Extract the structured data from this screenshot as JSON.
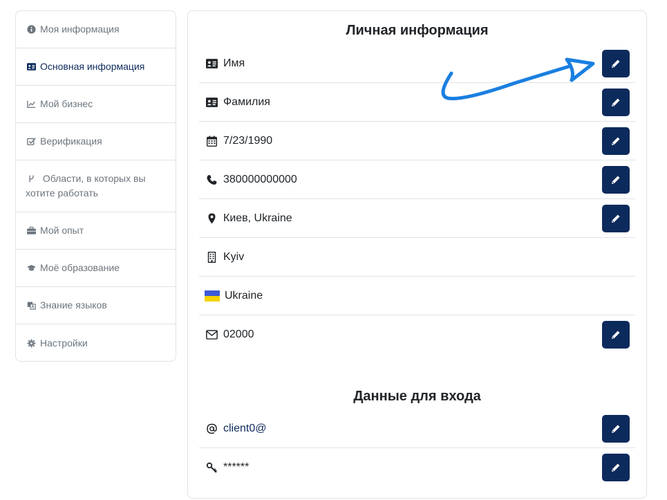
{
  "sidebar": {
    "items": [
      {
        "label": "Моя информация",
        "icon": "info-icon"
      },
      {
        "label": "Основная информация",
        "icon": "id-card-icon",
        "active": true
      },
      {
        "label": "Мой бизнес",
        "icon": "line-chart-icon"
      },
      {
        "label": "Верификация",
        "icon": "checkbox-icon"
      },
      {
        "label": "Области, в которых вы хотите работать",
        "icon": "branch-icon"
      },
      {
        "label": "Мой опыт",
        "icon": "briefcase-icon"
      },
      {
        "label": "Моё образование",
        "icon": "graduation-cap-icon"
      },
      {
        "label": "Знание языков",
        "icon": "language-icon"
      },
      {
        "label": "Настройки",
        "icon": "gear-icon"
      }
    ]
  },
  "personal": {
    "title": "Личная информация",
    "rows": [
      {
        "icon": "id-card-icon",
        "value": "Имя",
        "editable": true
      },
      {
        "icon": "id-card-icon",
        "value": "Фамилия",
        "editable": true
      },
      {
        "icon": "calendar-icon",
        "value": "7/23/1990",
        "editable": true
      },
      {
        "icon": "phone-icon",
        "value": "380000000000",
        "editable": true
      },
      {
        "icon": "map-marker-icon",
        "value": "Киев, Ukraine",
        "editable": true
      },
      {
        "icon": "building-icon",
        "value": "Kyiv",
        "editable": false
      },
      {
        "icon": "ukraine-flag-icon",
        "value": "Ukraine",
        "editable": false
      },
      {
        "icon": "envelope-icon",
        "value": "02000",
        "editable": true
      }
    ]
  },
  "login": {
    "title": "Данные для входа",
    "rows": [
      {
        "icon": "at-icon",
        "value": "client0@",
        "editable": true
      },
      {
        "icon": "key-icon",
        "value": "******",
        "editable": true
      }
    ]
  },
  "colors": {
    "accent": "#0d2a5c",
    "annotation_arrow": "#1a7fe0"
  }
}
